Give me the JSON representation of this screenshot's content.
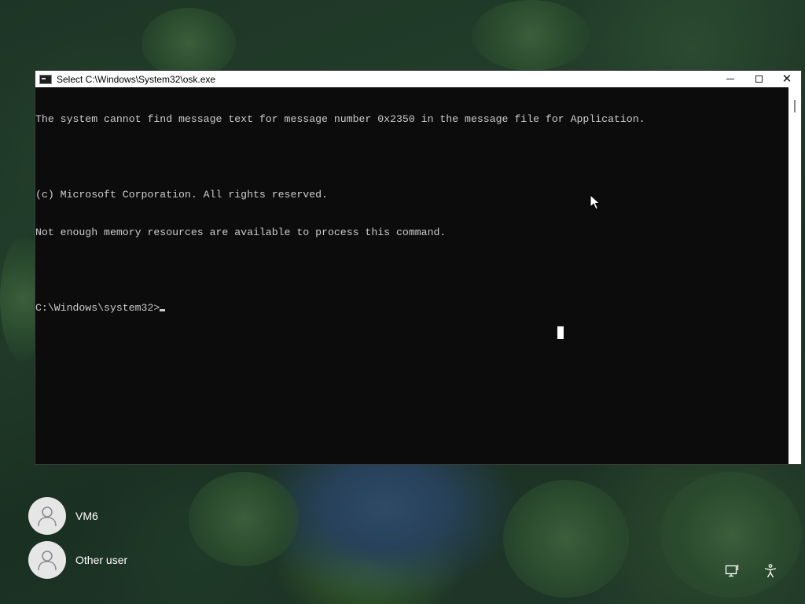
{
  "window": {
    "title": "Select C:\\Windows\\System32\\osk.exe",
    "minimize_icon": "minimize-icon",
    "maximize_icon": "maximize-icon",
    "close_icon": "close-icon"
  },
  "console": {
    "lines": [
      "The system cannot find message text for message number 0x2350 in the message file for Application.",
      "",
      "(c) Microsoft Corporation. All rights reserved.",
      "Not enough memory resources are available to process this command.",
      "",
      "C:\\Windows\\system32>"
    ],
    "background": "#0c0c0c",
    "foreground": "#cccccc"
  },
  "users": [
    {
      "name": "VM6",
      "icon": "user-icon"
    },
    {
      "name": "Other user",
      "icon": "user-icon"
    }
  ],
  "corner_icons": {
    "network": "network-icon",
    "accessibility": "accessibility-icon"
  }
}
